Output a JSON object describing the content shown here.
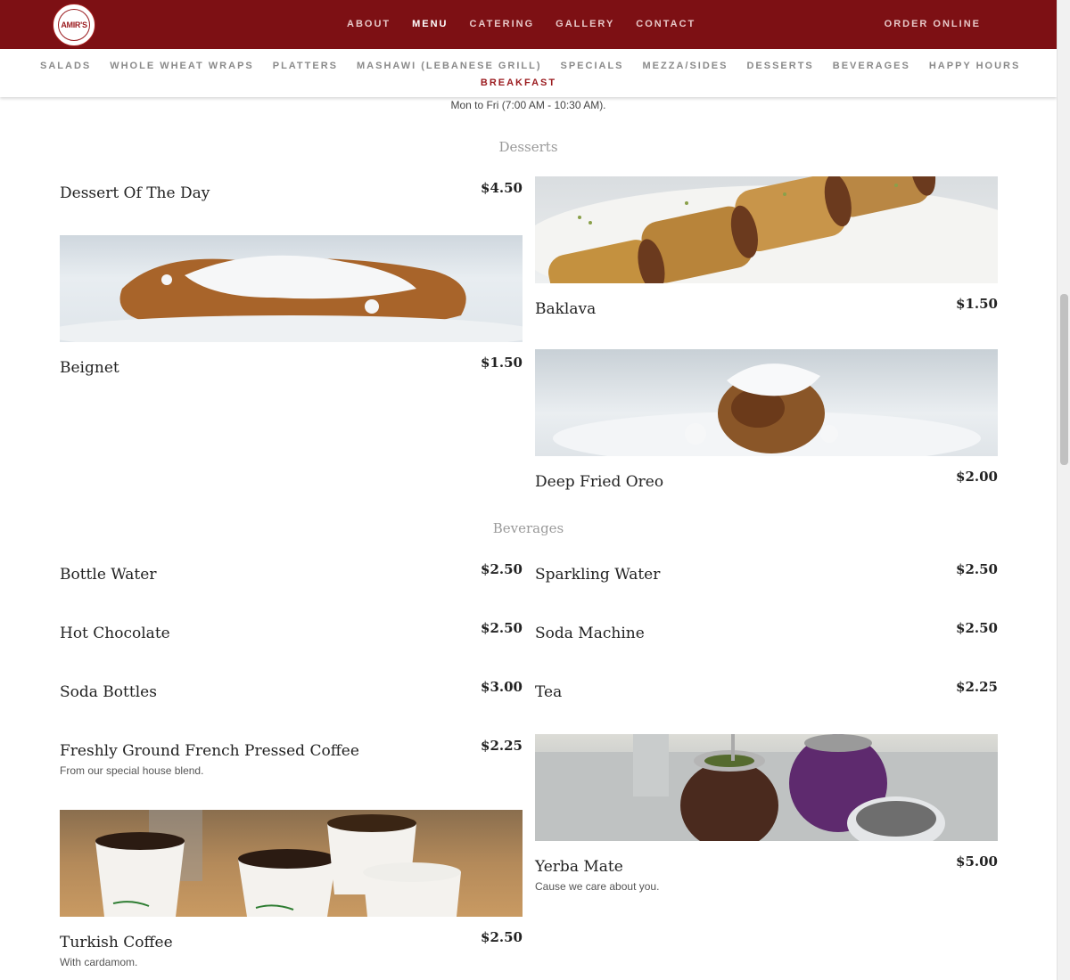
{
  "header": {
    "logo_text": "AMIR'S",
    "nav": [
      "ABOUT",
      "MENU",
      "CATERING",
      "GALLERY",
      "CONTACT"
    ],
    "active_nav": "MENU",
    "order_label": "ORDER ONLINE",
    "brand_color": "#7d1014"
  },
  "categories": {
    "items": [
      "SALADS",
      "WHOLE WHEAT WRAPS",
      "PLATTERS",
      "MASHAWI (LEBANESE GRILL)",
      "SPECIALS",
      "MEZZA/SIDES",
      "DESSERTS",
      "BEVERAGES",
      "HAPPY HOURS"
    ],
    "active": "BREAKFAST"
  },
  "hours_note": "Mon to Fri (7:00 AM - 10:30 AM).",
  "desserts": {
    "title": "Desserts",
    "items": [
      {
        "name": "Dessert Of The Day",
        "price": "$4.50"
      },
      {
        "name": "Baklava",
        "price": "$1.50"
      },
      {
        "name": "Beignet",
        "price": "$1.50"
      },
      {
        "name": "Deep Fried Oreo",
        "price": "$2.00"
      }
    ]
  },
  "beverages": {
    "title": "Beverages",
    "items": [
      {
        "name": "Bottle Water",
        "price": "$2.50"
      },
      {
        "name": "Sparkling Water",
        "price": "$2.50"
      },
      {
        "name": "Hot Chocolate",
        "price": "$2.50"
      },
      {
        "name": "Soda Machine",
        "price": "$2.50"
      },
      {
        "name": "Soda Bottles",
        "price": "$3.00"
      },
      {
        "name": "Tea",
        "price": "$2.25"
      },
      {
        "name": "Freshly Ground French Pressed Coffee",
        "price": "$2.25",
        "desc": "From our special house blend."
      },
      {
        "name": "Yerba Mate",
        "price": "$5.00",
        "desc": "Cause we care about you."
      },
      {
        "name": "Turkish Coffee",
        "price": "$2.50",
        "desc": "With cardamom."
      }
    ]
  }
}
